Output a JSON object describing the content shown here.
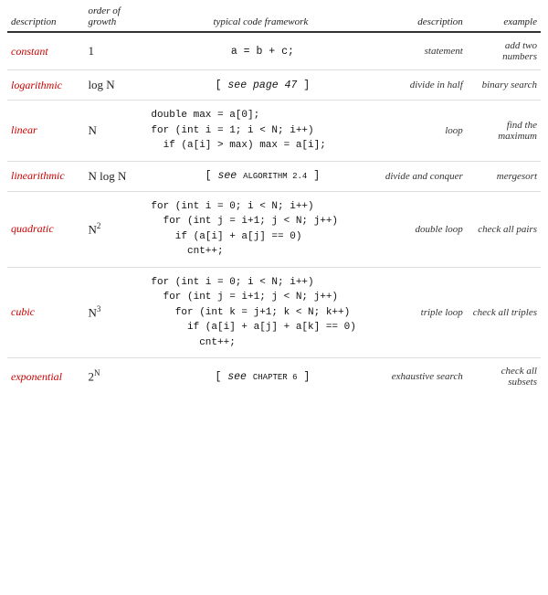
{
  "header": {
    "col1": "description",
    "col2": "order of growth",
    "col3": "typical code framework",
    "col4": "description",
    "col5": "example"
  },
  "rows": [
    {
      "name": "constant",
      "order": "1",
      "order_html": "1",
      "code_html": "a = b + c;",
      "desc2": "statement",
      "example": "add two numbers"
    },
    {
      "name": "logarithmic",
      "order": "log N",
      "order_html": "log N",
      "code_html": "[ <i>see page 47</i> ]",
      "desc2": "divide in half",
      "example": "binary search"
    },
    {
      "name": "linear",
      "order": "N",
      "order_html": "N",
      "code_html": "double max = a[0];\nfor (int i = 1; i < N; i++)\n  if (a[i] > max) max = a[i];",
      "desc2": "loop",
      "example": "find the maximum"
    },
    {
      "name": "linearithmic",
      "order": "N log N",
      "order_html": "N log N",
      "code_html": "[ <i>see</i> <span class=\"algo-small\">ALGORITHM 2.4</span> ]",
      "desc2": "divide and conquer",
      "example": "mergesort"
    },
    {
      "name": "quadratic",
      "order": "N²",
      "order_html": "N<sup>2</sup>",
      "code_html": "for (int i = 0; i < N; i++)\n  for (int j = i+1; j < N; j++)\n    if (a[i] + a[j] == 0)\n      cnt++;",
      "desc2": "double loop",
      "example": "check all pairs"
    },
    {
      "name": "cubic",
      "order": "N³",
      "order_html": "N<sup>3</sup>",
      "code_html": "for (int i = 0; i < N; i++)\n  for (int j = i+1; j < N; j++)\n    for (int k = j+1; k < N; k++)\n      if (a[i] + a[j] + a[k] == 0)\n        cnt++;",
      "desc2": "triple loop",
      "example": "check all triples"
    },
    {
      "name": "exponential",
      "order": "2^N",
      "order_html": "2<sup>N</sup>",
      "code_html": "[ <i>see</i> <span class=\"ch-small\">CHAPTER 6</span> ]",
      "desc2": "exhaustive search",
      "example": "check all subsets"
    }
  ]
}
